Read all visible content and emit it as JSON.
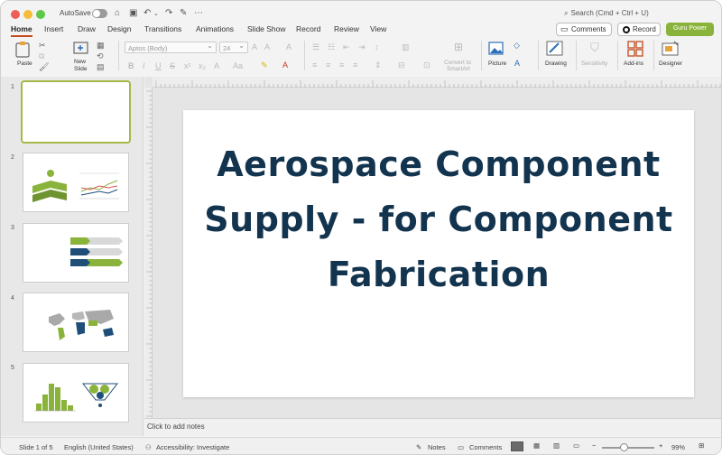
{
  "titlebar": {
    "autosave_label": "AutoSave",
    "search_placeholder": "Search (Cmd + Ctrl + U)"
  },
  "tabs": [
    "Home",
    "Insert",
    "Draw",
    "Design",
    "Transitions",
    "Animations",
    "Slide Show",
    "Record",
    "Review",
    "View"
  ],
  "actions": {
    "comments": "Comments",
    "record": "Record",
    "guru": "Guru Power"
  },
  "ribbon": {
    "paste": "Paste",
    "new_slide_line1": "New",
    "new_slide_line2": "Slide",
    "font_name": "Aptos (Body)",
    "font_size": "24",
    "convert_line1": "Convert to",
    "convert_line2": "SmartArt",
    "picture": "Picture",
    "drawing": "Drawing",
    "sensitivity": "Sensitivity",
    "addins": "Add-ins",
    "designer": "Designer"
  },
  "slides_panel": {
    "numbers": [
      "1",
      "2",
      "3",
      "4",
      "5"
    ]
  },
  "slide": {
    "title": "Aerospace Component Supply - for Component Fabrication"
  },
  "notes": {
    "placeholder": "Click to add notes"
  },
  "status": {
    "slide_of": "Slide 1 of 5",
    "language": "English (United States)",
    "accessibility": "Accessibility: Investigate",
    "notes": "Notes",
    "comments": "Comments",
    "zoom": "99%"
  },
  "colors": {
    "title_text": "#13344f",
    "accent_green": "#8ab33b",
    "tab_underline": "#c44a1e",
    "chart_blue": "#1f4e79"
  }
}
